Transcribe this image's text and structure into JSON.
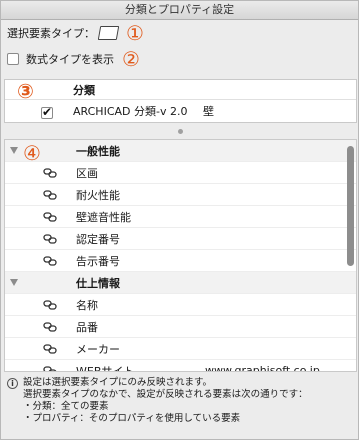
{
  "window": {
    "title": "分類とプロパティ設定"
  },
  "element_type": {
    "label": "選択要素タイプ：",
    "icon": "wall-element-icon"
  },
  "formula_toggle": {
    "label": "数式タイプを表示",
    "checked": false
  },
  "callouts": [
    "①",
    "②",
    "③",
    "④"
  ],
  "classification_panel": {
    "header": "分類",
    "rows": [
      {
        "checked": true,
        "name": "ARCHICAD 分類-v 2.0",
        "value": "壁"
      }
    ]
  },
  "property_panel": {
    "rows": [
      {
        "kind": "group",
        "label": "一般性能"
      },
      {
        "kind": "prop",
        "label": "区画",
        "value": ""
      },
      {
        "kind": "prop",
        "label": "耐火性能",
        "value": ""
      },
      {
        "kind": "prop",
        "label": "壁遮音性能",
        "value": ""
      },
      {
        "kind": "prop",
        "label": "認定番号",
        "value": ""
      },
      {
        "kind": "prop",
        "label": "告示番号",
        "value": ""
      },
      {
        "kind": "group",
        "label": "仕上情報"
      },
      {
        "kind": "prop",
        "label": "名称",
        "value": ""
      },
      {
        "kind": "prop",
        "label": "品番",
        "value": ""
      },
      {
        "kind": "prop",
        "label": "メーカー",
        "value": ""
      },
      {
        "kind": "prop",
        "label": "WEBサイト",
        "value": "www.graphisoft.co.jp"
      }
    ]
  },
  "info": {
    "icon": "info-icon",
    "glyph": "i",
    "lines": [
      "設定は選択要素タイプにのみ反映されます。",
      "選択要素タイプのなかで、設定が反映される要素は次の通りです：",
      "・分類：全ての要素",
      "・プロパティ：そのプロパティを使用している要素"
    ]
  }
}
